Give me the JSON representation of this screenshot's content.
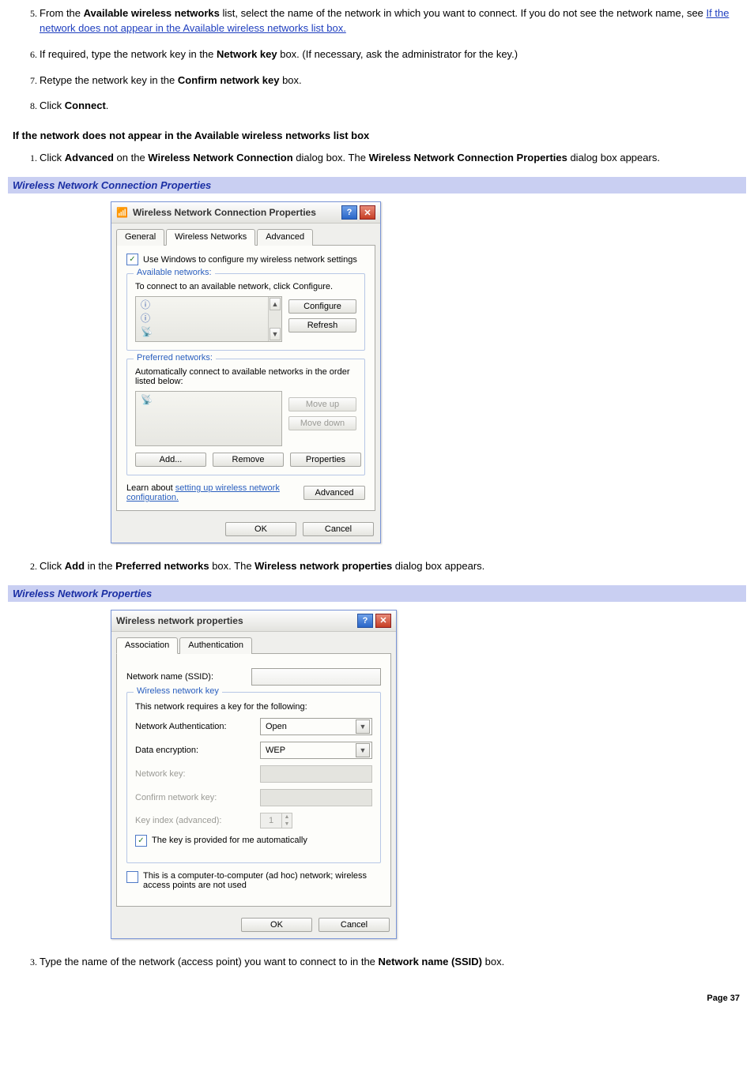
{
  "steps_a": {
    "s5_pre": "From the ",
    "s5_b1": "Available wireless networks",
    "s5_mid": " list, select the name of the network in which you want to connect. If you do not see the network name, see ",
    "s5_link": "If the network does not appear in the Available wireless networks list box.",
    "s6_pre": "If required, type the network key in the ",
    "s6_b1": "Network key",
    "s6_post": " box. (If necessary, ask the administrator for the key.)",
    "s7_pre": "Retype the network key in the ",
    "s7_b1": "Confirm network key",
    "s7_post": " box.",
    "s8_pre": "Click ",
    "s8_b1": "Connect",
    "s8_post": "."
  },
  "section1_heading": "If the network does not appear in the Available wireless networks list box",
  "steps_b": {
    "s1_pre": "Click ",
    "s1_b1": "Advanced",
    "s1_mid1": " on the ",
    "s1_b2": "Wireless Network Connection",
    "s1_mid2": " dialog box. The ",
    "s1_b3": "Wireless Network Connection Properties",
    "s1_post": " dialog box appears."
  },
  "caption1": "Wireless Network Connection Properties",
  "dialog1": {
    "title": "Wireless Network Connection Properties",
    "tabs": [
      "General",
      "Wireless Networks",
      "Advanced"
    ],
    "use_windows": "Use Windows to configure my wireless network settings",
    "available": {
      "legend": "Available networks:",
      "desc": "To connect to an available network, click Configure.",
      "configure": "Configure",
      "refresh": "Refresh"
    },
    "preferred": {
      "legend": "Preferred networks:",
      "desc": "Automatically connect to available networks in the order listed below:",
      "moveup": "Move up",
      "movedown": "Move down",
      "add": "Add...",
      "remove": "Remove",
      "properties": "Properties"
    },
    "learn_pre": "Learn about ",
    "learn_link": "setting up wireless network configuration.",
    "advanced_btn": "Advanced",
    "ok": "OK",
    "cancel": "Cancel"
  },
  "steps_c": {
    "s2_pre": "Click ",
    "s2_b1": "Add",
    "s2_mid1": " in the ",
    "s2_b2": "Preferred networks",
    "s2_mid2": " box. The ",
    "s2_b3": "Wireless network properties",
    "s2_post": " dialog box appears."
  },
  "caption2": "Wireless Network Properties",
  "dialog2": {
    "title": "Wireless network properties",
    "tabs": [
      "Association",
      "Authentication"
    ],
    "ssid_label": "Network name (SSID):",
    "fieldset_legend": "Wireless network key",
    "requires": "This network requires a key for the following:",
    "netauth_label": "Network Authentication:",
    "netauth_value": "Open",
    "dataenc_label": "Data encryption:",
    "dataenc_value": "WEP",
    "netkey_label": "Network key:",
    "confirmkey_label": "Confirm network key:",
    "keyindex_label": "Key index (advanced):",
    "keyindex_value": "1",
    "auto_key": "The key is provided for me automatically",
    "adhoc": "This is a computer-to-computer (ad hoc) network; wireless access points are not used",
    "ok": "OK",
    "cancel": "Cancel"
  },
  "steps_d": {
    "s3_pre": "Type the name of the network (access point) you want to connect to in the ",
    "s3_b1": "Network name (SSID)",
    "s3_post": " box."
  },
  "page_footer": "Page 37"
}
